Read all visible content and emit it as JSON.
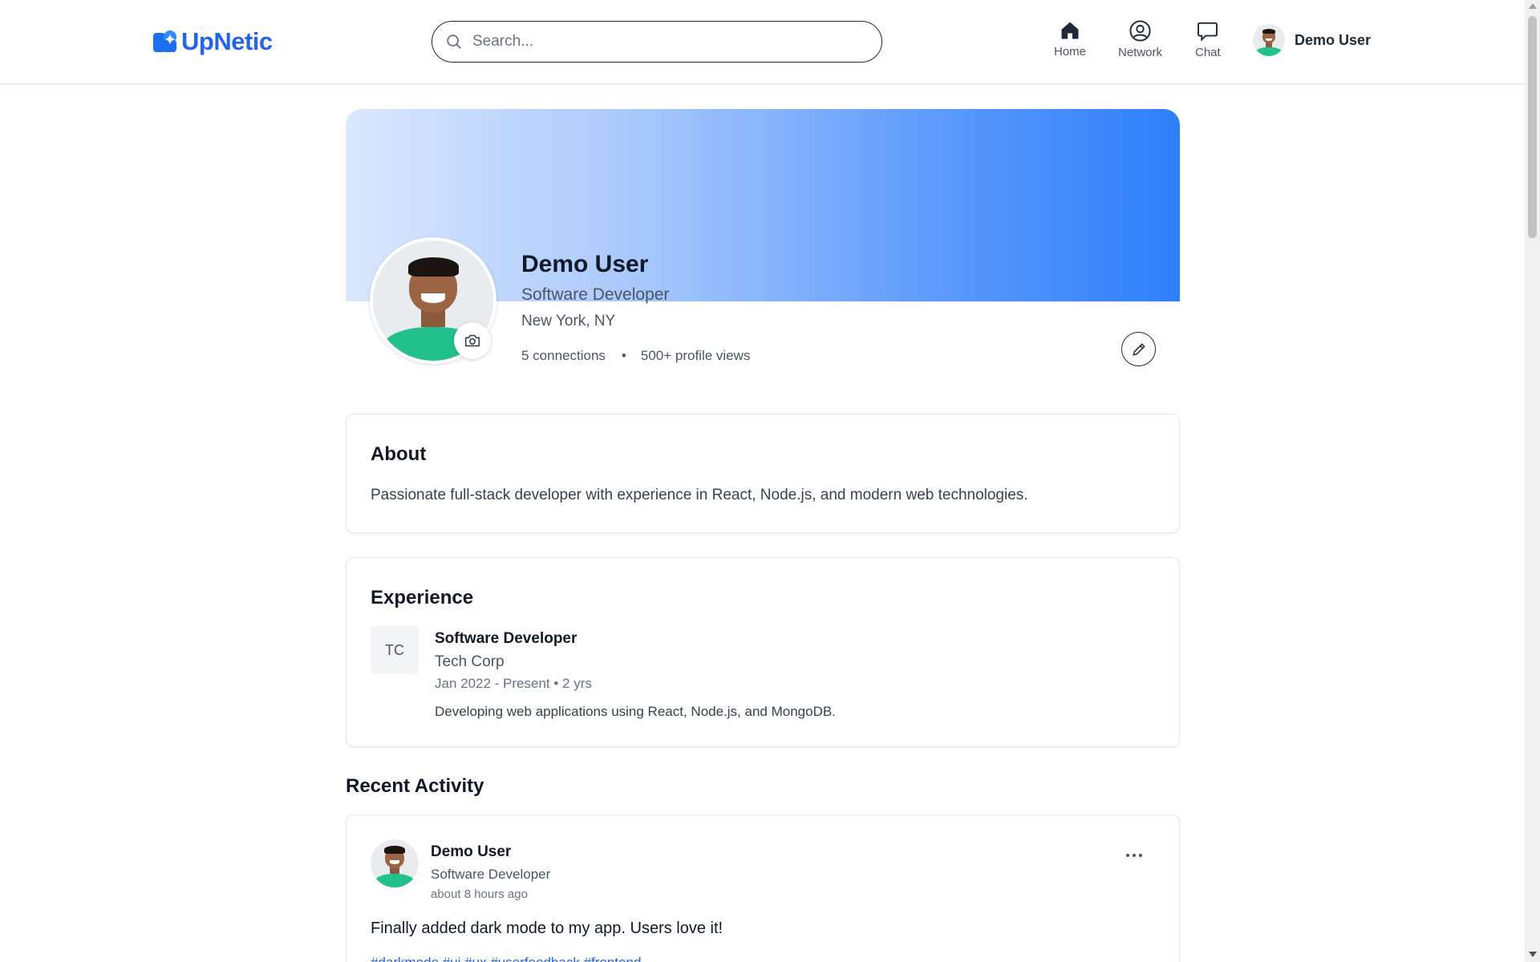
{
  "brand": {
    "name": "UpNetic",
    "color": "#2563eb"
  },
  "search": {
    "placeholder": "Search..."
  },
  "nav": {
    "home": {
      "label": "Home",
      "icon": "home-icon"
    },
    "network": {
      "label": "Network",
      "icon": "user-circle-icon"
    },
    "chat": {
      "label": "Chat",
      "icon": "chat-bubble-icon"
    }
  },
  "current_user": {
    "name": "Demo User"
  },
  "profile": {
    "name": "Demo User",
    "title": "Software Developer",
    "location": "New York, NY",
    "connections": "5 connections",
    "separator": "•",
    "views": "500+ profile views"
  },
  "about": {
    "heading": "About",
    "text": "Passionate full-stack developer with experience in React, Node.js, and modern web technologies."
  },
  "experience": {
    "heading": "Experience",
    "items": [
      {
        "logo_text": "TC",
        "role": "Software Developer",
        "company": "Tech Corp",
        "dates": "Jan 2022 - Present • 2 yrs",
        "description": "Developing web applications using React, Node.js, and MongoDB."
      }
    ]
  },
  "activity": {
    "heading": "Recent Activity",
    "posts": [
      {
        "author": "Demo User",
        "role": "Software Developer",
        "time": "about 8 hours ago",
        "text": "Finally added dark mode to my app. Users love it!",
        "tags": "#darkmode #ui #ux #userfeedback #frontend"
      }
    ]
  }
}
